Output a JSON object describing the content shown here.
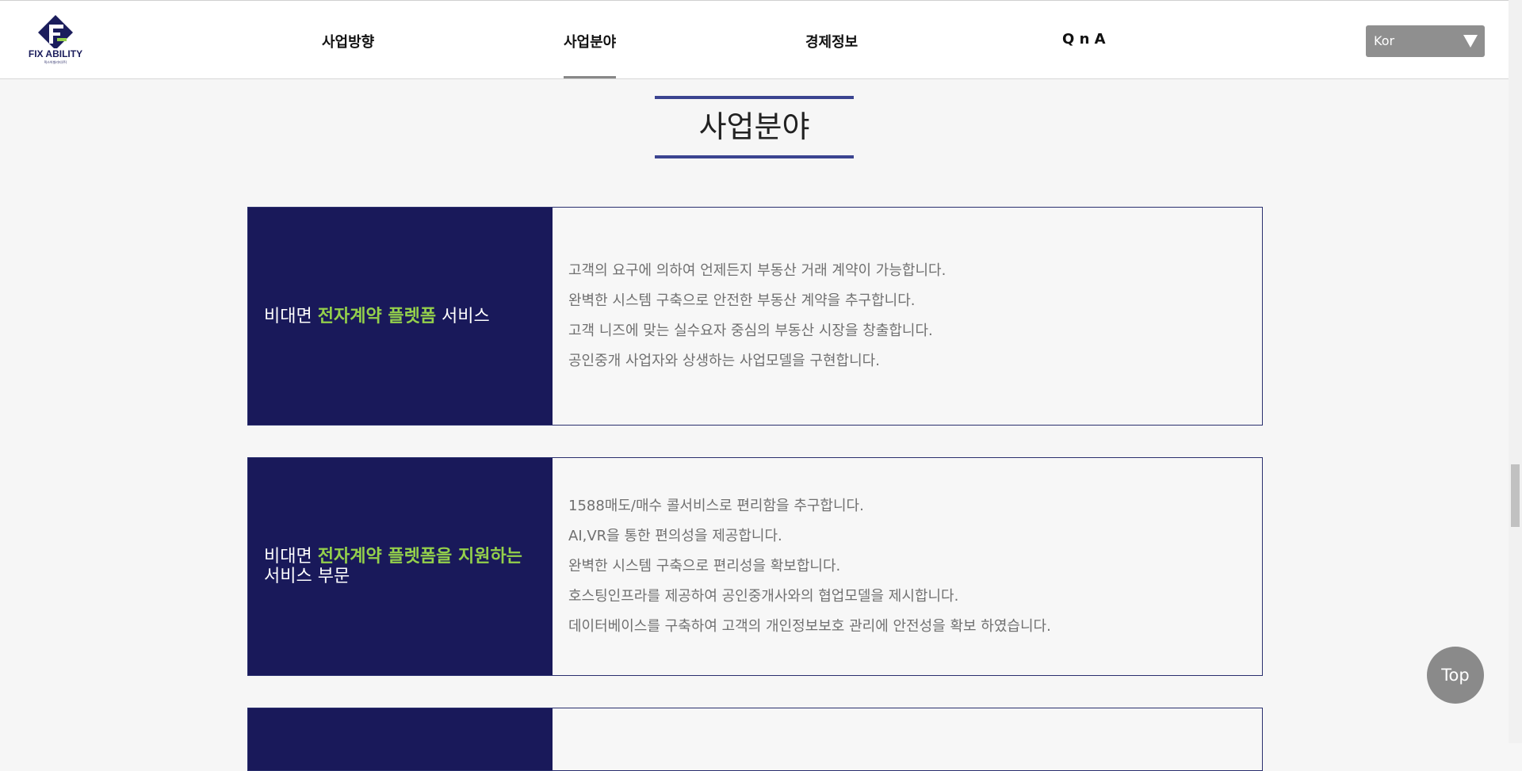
{
  "header": {
    "logo_text": "FIX ABILITY",
    "logo_subtext": "픽스어빌리티(주)",
    "nav": [
      "사업방향",
      "사업분야",
      "경제정보",
      "Q n A"
    ],
    "active_nav": "사업분야",
    "language": "Kor"
  },
  "section": {
    "title": "사업분야"
  },
  "cards": [
    {
      "heading_pre": "비대면 ",
      "heading_highlight": "전자계약 플렛폼",
      "heading_post": " 서비스",
      "lines": [
        "고객의 요구에 의하여 언제든지 부동산 거래 계약이 가능합니다.",
        "완벽한 시스템 구축으로 안전한 부동산 계약을 추구합니다.",
        "고객 니즈에 맞는 실수요자 중심의 부동산 시장을 창출합니다.",
        "공인중개 사업자와 상생하는 사업모델을 구현합니다."
      ]
    },
    {
      "heading_pre": "비대면 ",
      "heading_highlight": "전자계약 플렛폼을 지원하는",
      "heading_post": " 서비스 부문",
      "lines": [
        "1588매도/매수 콜서비스로 편리함을 추구합니다.",
        "AI,VR을 통한 편의성을 제공합니다.",
        "완벽한 시스템 구축으로 편리성을 확보합니다.",
        "호스팅인프라를 제공하여 공인중개사와의 협업모델을 제시합니다.",
        "데이터베이스를 구축하여 고객의 개인정보보호 관리에 안전성을 확보 하였습니다."
      ]
    }
  ],
  "top_button": "Top",
  "colors": {
    "brand_navy": "#19195a",
    "highlight_green": "#94d04b",
    "title_border": "#3b4490",
    "lang_bg": "#8f8f8f"
  }
}
